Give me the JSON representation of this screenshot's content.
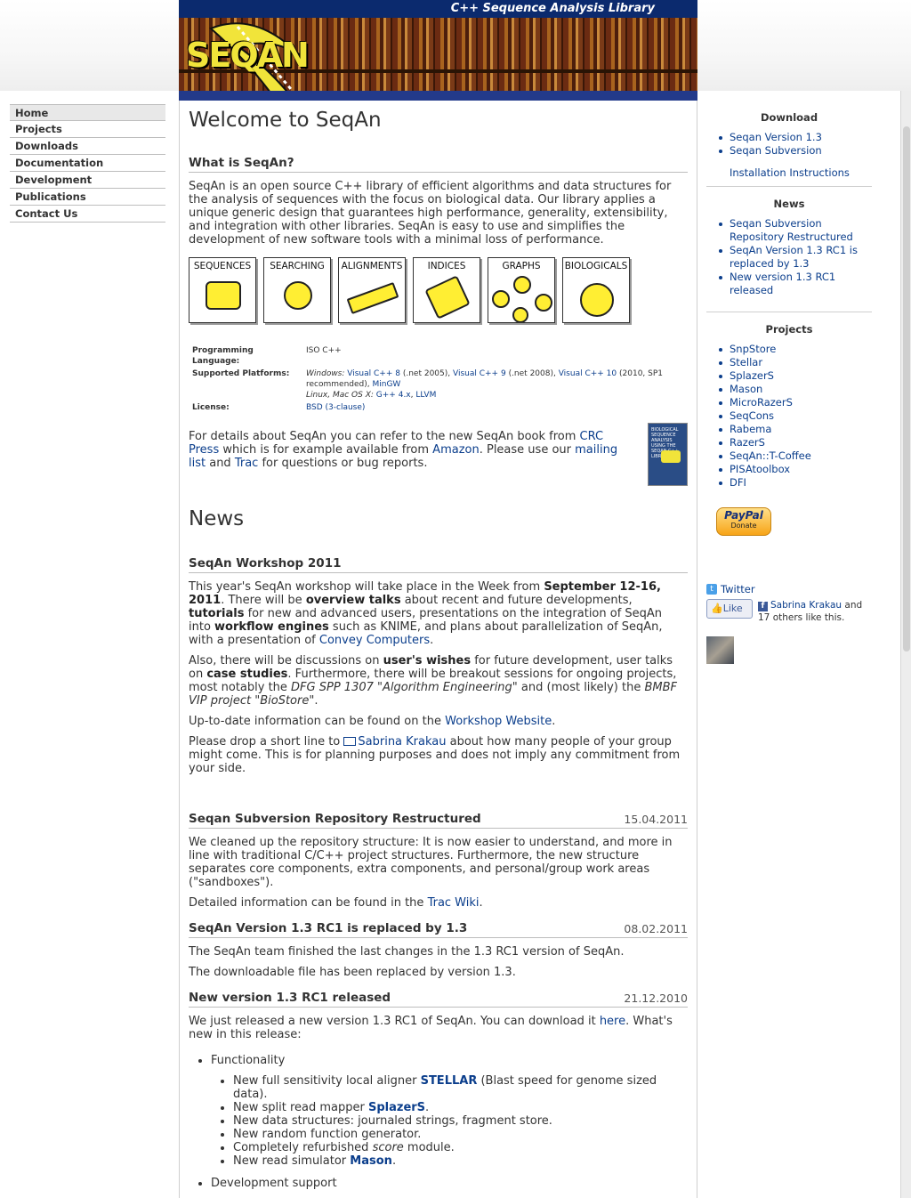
{
  "header": {
    "banner_title": "C++ Sequence Analysis Library",
    "logo_text": "SEQAN"
  },
  "nav": {
    "items": [
      {
        "label": "Home"
      },
      {
        "label": "Projects"
      },
      {
        "label": "Downloads"
      },
      {
        "label": "Documentation"
      },
      {
        "label": "Development"
      },
      {
        "label": "Publications"
      },
      {
        "label": "Contact Us"
      }
    ]
  },
  "main": {
    "title": "Welcome to SeqAn",
    "what_heading": "What is SeqAn?",
    "what_text": "SeqAn is an open source C++ library of efficient algorithms and data structures for the analysis of sequences with the focus on biological data. Our library applies a unique generic design that guarantees high performance, generality, extensibility, and integration with other libraries. SeqAn is easy to use and simplifies the development of new software tools with a minimal loss of performance.",
    "categories": [
      "SEQUENCES",
      "SEARCHING",
      "ALIGNMENTS",
      "INDICES",
      "GRAPHS",
      "BIOLOGICALS"
    ],
    "info": {
      "lang_key": "Programming Language:",
      "lang_val": "ISO C++",
      "plat_key": "Supported Platforms:",
      "plat_win_prefix": "Windows:",
      "plat_vc8": "Visual C++ 8",
      "plat_vc8_note": "(.net 2005),",
      "plat_vc9": "Visual C++ 9",
      "plat_vc9_note": "(.net 2008),",
      "plat_vc10": "Visual C++ 10",
      "plat_vc10_note": "(2010, SP1 recommended),",
      "plat_mingw": "MinGW",
      "plat_unix_prefix": "Linux, Mac OS X:",
      "plat_gcc": "G++ 4.x",
      "plat_llvm": "LLVM",
      "license_key": "License:",
      "license_val": "BSD (3-clause)"
    },
    "book_text": "BIOLOGICAL SEQUENCE ANALYSIS USING THE SEQAN C++ LIBRARY",
    "details_p1": "For details about SeqAn you can refer to the new SeqAn book from ",
    "details_crc": "CRC Press",
    "details_p2": " which is for example available from ",
    "details_amazon": "Amazon",
    "details_p3": ". Please use our ",
    "details_mailing": "mailing list",
    "details_p4": " and ",
    "details_trac": "Trac",
    "details_p5": " for questions or bug reports.",
    "news_title": "News",
    "ws_heading": "SeqAn Workshop 2011",
    "ws_p1_a": "This year's SeqAn workshop will take place in the Week from ",
    "ws_p1_date": "September 12-16, 2011",
    "ws_p1_b": ". There will be ",
    "ws_p1_overview": "overview talks",
    "ws_p1_c": " about recent and future developments, ",
    "ws_p1_tutorials": "tutorials",
    "ws_p1_d": " for new and advanced users, presentations on the integration of SeqAn into ",
    "ws_p1_workflow": "workflow engines",
    "ws_p1_e": " such as KNIME, and plans about parallelization of SeqAn, with a presentation of ",
    "ws_p1_convey": "Convey Computers",
    "ws_p1_f": ".",
    "ws_p2_a": "Also, there will be discussions on ",
    "ws_p2_wishes": "user's wishes",
    "ws_p2_b": " for future development, user talks on ",
    "ws_p2_case": "case studies",
    "ws_p2_c": ". Furthermore, there will be breakout sessions for ongoing projects, most notably the ",
    "ws_p2_dfg": "DFG SPP 1307 \"Algorithm Engineering\"",
    "ws_p2_d": " and (most likely) the ",
    "ws_p2_bmbf": "BMBF VIP project \"BioStore\"",
    "ws_p2_e": ".",
    "ws_p3_a": "Up-to-date information can be found on the ",
    "ws_p3_link": "Workshop Website",
    "ws_p3_b": ".",
    "ws_p4_a": "Please drop a short line to ",
    "ws_p4_link": "Sabrina Krakau",
    "ws_p4_b": " about how many people of your group might come. This is for planning purposes and does not imply any commitment from your side.",
    "svn_heading": "Seqan Subversion Repository Restructured",
    "svn_date": "15.04.2011",
    "svn_p1": "We cleaned up the repository structure: It is now easier to understand, and more in line with traditional C/C++ project structures. Furthermore, the new structure separates core components, extra components, and personal/group work areas (\"sandboxes\").",
    "svn_p2_a": "Detailed information can be found in the ",
    "svn_p2_link": "Trac Wiki",
    "svn_p2_b": ".",
    "v13_heading": "SeqAn Version 1.3 RC1 is replaced by 1.3",
    "v13_date": "08.02.2011",
    "v13_p1": "The SeqAn team finished the last changes in the 1.3 RC1 version of SeqAn.",
    "v13_p2": "The downloadable file has been replaced by version 1.3.",
    "rc1_heading": "New version 1.3 RC1 released",
    "rc1_date": "21.12.2010",
    "rc1_p1_a": "We just released a new version 1.3 RC1 of SeqAn. You can download it ",
    "rc1_p1_link": "here",
    "rc1_p1_b": ". What's new in this release:",
    "feat_functionality": "Functionality",
    "feat_1_a": "New full sensitivity local aligner ",
    "feat_1_link": "STELLAR",
    "feat_1_b": " (Blast speed for genome sized data).",
    "feat_2_a": "New split read mapper ",
    "feat_2_link": "SplazerS",
    "feat_2_b": ".",
    "feat_3": "New data structures: journaled strings, fragment store.",
    "feat_4": "New random function generator.",
    "feat_5_a": "Completely refurbished ",
    "feat_5_em": "score",
    "feat_5_b": " module.",
    "feat_6_a": "New read simulator ",
    "feat_6_link": "Mason",
    "feat_6_b": ".",
    "feat_devsupport": "Development support"
  },
  "sidebar": {
    "download_heading": "Download",
    "download_items": [
      "Seqan Version 1.3",
      "Seqan Subversion"
    ],
    "install_link": "Installation Instructions",
    "news_heading": "News",
    "news_items": [
      "Seqan Subversion Repository Restructured",
      "SeqAn Version 1.3 RC1 is replaced by 1.3",
      "New version 1.3 RC1 released"
    ],
    "projects_heading": "Projects",
    "projects_items": [
      "SnpStore",
      "Stellar",
      "SplazerS",
      "Mason",
      "MicroRazerS",
      "SeqCons",
      "Rabema",
      "RazerS",
      "SeqAn::T-Coffee",
      "PISAtoolbox",
      "DFI"
    ],
    "paypal_label": "PayPal",
    "paypal_donate": "Donate",
    "twitter_label": "Twitter",
    "like_label": "Like",
    "fb_name": "Sabrina Krakau",
    "fb_and": " and",
    "fb_others": "17 others like this."
  }
}
